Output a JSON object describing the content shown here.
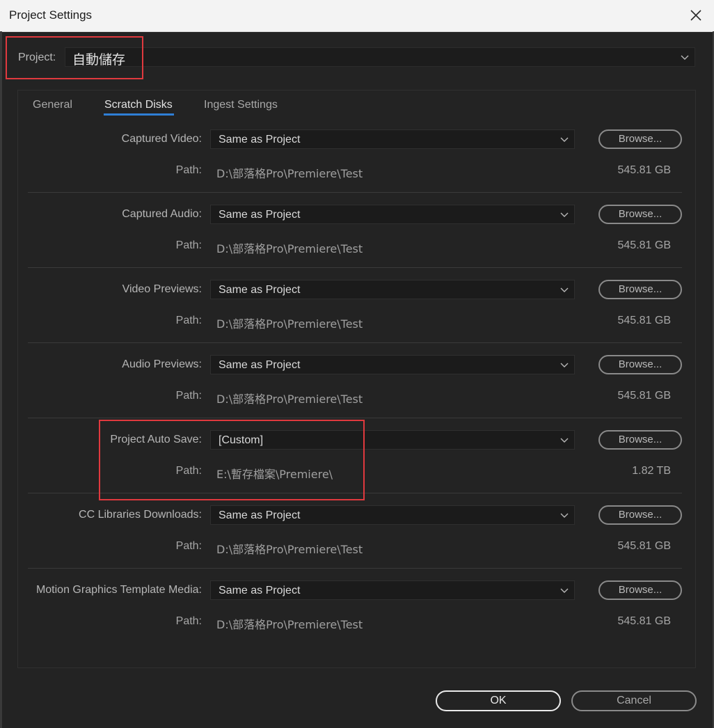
{
  "window": {
    "title": "Project Settings"
  },
  "project": {
    "label": "Project:",
    "value": "自動儲存"
  },
  "tabs": [
    {
      "label": "General"
    },
    {
      "label": "Scratch Disks"
    },
    {
      "label": "Ingest Settings"
    }
  ],
  "path_label": "Path:",
  "browse_label": "Browse...",
  "rows": [
    {
      "label": "Captured Video:",
      "value": "Same as Project",
      "path": "D:\\部落格Pro\\Premiere\\Test",
      "size": "545.81 GB"
    },
    {
      "label": "Captured Audio:",
      "value": "Same as Project",
      "path": "D:\\部落格Pro\\Premiere\\Test",
      "size": "545.81 GB"
    },
    {
      "label": "Video Previews:",
      "value": "Same as Project",
      "path": "D:\\部落格Pro\\Premiere\\Test",
      "size": "545.81 GB"
    },
    {
      "label": "Audio Previews:",
      "value": "Same as Project",
      "path": "D:\\部落格Pro\\Premiere\\Test",
      "size": "545.81 GB"
    },
    {
      "label": "Project Auto Save:",
      "value": "[Custom]",
      "path": "E:\\暫存檔案\\Premiere\\",
      "size": "1.82 TB"
    },
    {
      "label": "CC Libraries Downloads:",
      "value": "Same as Project",
      "path": "D:\\部落格Pro\\Premiere\\Test",
      "size": "545.81 GB"
    },
    {
      "label": "Motion Graphics Template Media:",
      "value": "Same as Project",
      "path": "D:\\部落格Pro\\Premiere\\Test",
      "size": "545.81 GB"
    }
  ],
  "footer": {
    "ok_label": "OK",
    "cancel_label": "Cancel"
  },
  "colors": {
    "highlight": "#e0393e",
    "tab_underline": "#2f7fd6",
    "background": "#232323"
  },
  "icons": {
    "close": "close-icon",
    "dropdown": "chevron-down-icon"
  }
}
